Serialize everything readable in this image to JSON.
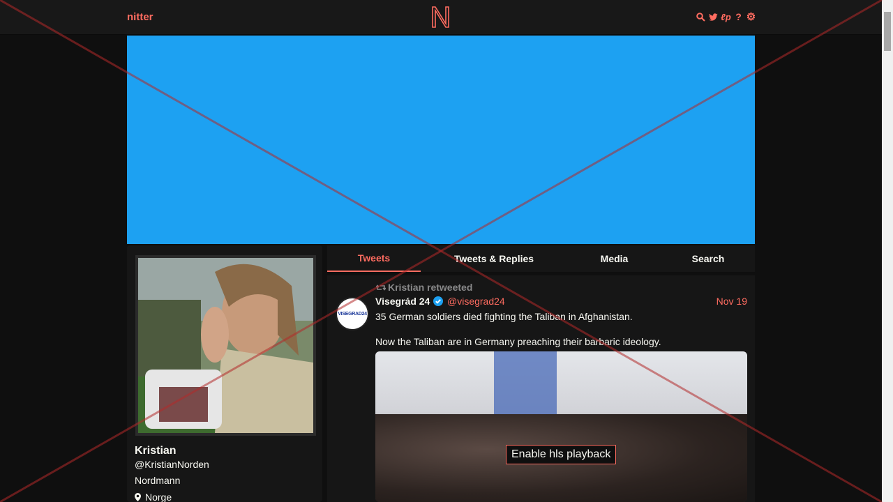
{
  "nav": {
    "brand": "nitter",
    "logo_letter": "N",
    "icons": [
      "search-icon",
      "twitter-bird-icon",
      "rss-icon",
      "help-icon",
      "gear-icon"
    ]
  },
  "colors": {
    "accent": "#ff6c60",
    "banner": "#1da1f2",
    "background": "#0f0f0f",
    "panel": "#161616"
  },
  "profile": {
    "name": "Kristian",
    "handle": "@KristianNorden",
    "bio": "Nordmann",
    "location": "Norge"
  },
  "tabs": [
    {
      "label": "Tweets",
      "active": true
    },
    {
      "label": "Tweets & Replies",
      "active": false
    },
    {
      "label": "Media",
      "active": false
    },
    {
      "label": "Search",
      "active": false
    }
  ],
  "tweet": {
    "retweet_label": "Kristian retweeted",
    "avatar_text": "VISEGRAD24",
    "fullname": "Visegrád 24",
    "username": "@visegrad24",
    "date": "Nov 19",
    "paragraphs": [
      "35 German soldiers died fighting the Taliban in Afghanistan.",
      "Now the Taliban are in Germany preaching their barbaric ideology."
    ],
    "media_button": "Enable hls playback"
  }
}
